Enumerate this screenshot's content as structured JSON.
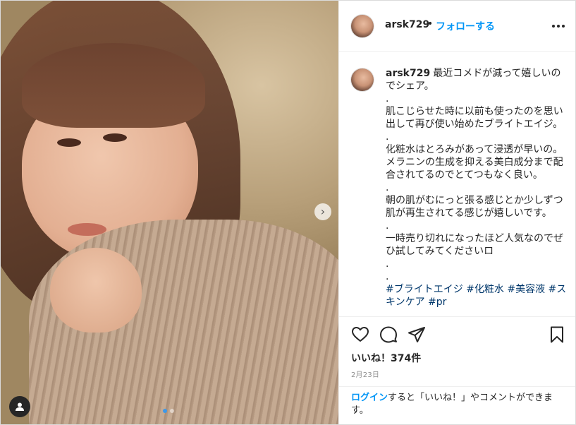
{
  "post": {
    "username": "arsk729",
    "follow_label": "フォローする",
    "separator": "•"
  },
  "caption": {
    "username": "arsk729",
    "text": "最近コメドが減って嬉しいのでシェア。\n.\n肌こじらせた時に以前も使ったのを思い出して再び使い始めたブライトエイジ。\n.\n化粧水はとろみがあって浸透が早いの。メラニンの生成を抑える美白成分まで配合されてるのでとてつもなく良い。\n.\n朝の肌がむにっと張る感じとか少しずつ肌が再生されてる感じが嬉しいです。\n.\n一時売り切れになったほど人気なのでぜひ試してみてくださいロ\n.\n.",
    "hashtags": "#ブライトエイジ #化粧水 #美容液 #スキンケア #pr"
  },
  "stats": {
    "likes": "いいね！374件",
    "date": "2月23日"
  },
  "login": {
    "link_label": "ログイン",
    "rest": "すると「いいね！」やコメントができます。"
  },
  "icons": {
    "like": "heart-icon",
    "comment": "comment-icon",
    "share": "share-icon",
    "save": "bookmark-icon",
    "more": "more-options-icon",
    "next": "chevron-right-icon",
    "tag": "user-tag-icon"
  },
  "colors": {
    "accent": "#0095f6",
    "hashtag": "#00376b",
    "text": "#262626",
    "muted": "#8e8e8e",
    "border": "#dbdbdb"
  },
  "carousel": {
    "total": 2,
    "active": 1
  }
}
